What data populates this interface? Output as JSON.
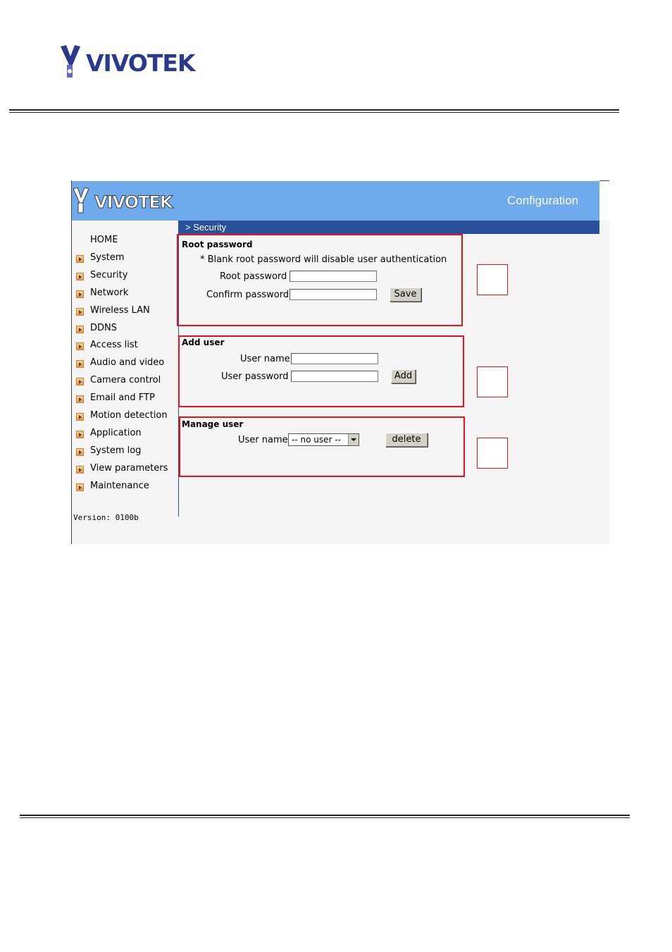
{
  "brand": {
    "logo_text": "VIVOTEK"
  },
  "config_page": {
    "banner_title": "Configuration",
    "section_title": "> Security",
    "sidebar": {
      "items": [
        {
          "label": "HOME",
          "arrow": false
        },
        {
          "label": "System",
          "arrow": true
        },
        {
          "label": "Security",
          "arrow": true
        },
        {
          "label": "Network",
          "arrow": true
        },
        {
          "label": "Wireless LAN",
          "arrow": true
        },
        {
          "label": "DDNS",
          "arrow": true
        },
        {
          "label": "Access list",
          "arrow": true
        },
        {
          "label": "Audio and video",
          "arrow": true
        },
        {
          "label": "Camera control",
          "arrow": true
        },
        {
          "label": "Email and FTP",
          "arrow": true
        },
        {
          "label": "Motion detection",
          "arrow": true
        },
        {
          "label": "Application",
          "arrow": true
        },
        {
          "label": "System log",
          "arrow": true
        },
        {
          "label": "View parameters",
          "arrow": true
        },
        {
          "label": "Maintenance",
          "arrow": true
        }
      ],
      "version": "Version: 0100b"
    },
    "root_password": {
      "heading": "Root password",
      "note": "* Blank root password will disable user authentication",
      "root_label": "Root password",
      "root_value": "",
      "confirm_label": "Confirm password",
      "confirm_value": "",
      "save_label": "Save"
    },
    "add_user": {
      "heading": "Add user",
      "username_label": "User name",
      "username_value": "",
      "password_label": "User password",
      "password_value": "",
      "add_label": "Add"
    },
    "manage_user": {
      "heading": "Manage user",
      "username_label": "User name",
      "selected_user": "-- no user --",
      "delete_label": "delete"
    }
  },
  "colors": {
    "banner": "#6eaaec",
    "section_bar": "#2a4f9b",
    "highlight_box": "#e8111c"
  }
}
